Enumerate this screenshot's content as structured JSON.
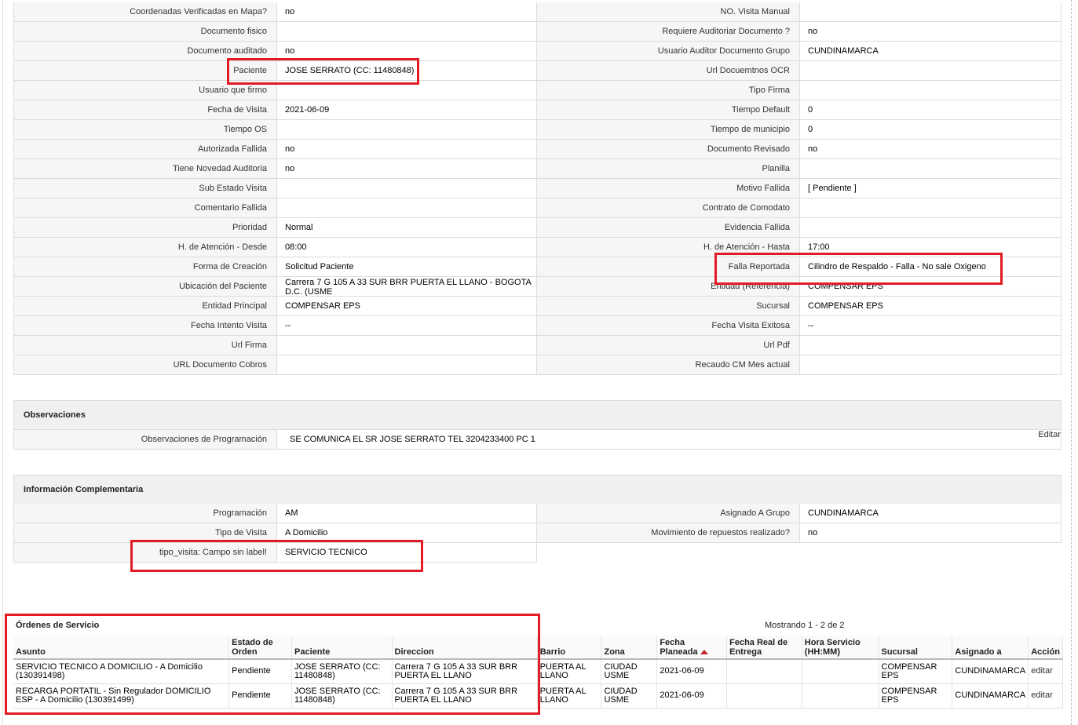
{
  "left_rows_top": [
    {
      "label": "Coordenadas Verificadas en Mapa?",
      "value": "no"
    },
    {
      "label": "Documento fisico",
      "value": ""
    },
    {
      "label": "Documento auditado",
      "value": "no"
    },
    {
      "label": "Paciente",
      "value": "JOSE SERRATO (CC: 11480848)"
    },
    {
      "label": "Usuario que firmo",
      "value": ""
    },
    {
      "label": "Fecha de Visita",
      "value": "2021-06-09"
    },
    {
      "label": "Tiempo OS",
      "value": ""
    },
    {
      "label": "Autorizada Fallida",
      "value": "no"
    },
    {
      "label": "Tiene Novedad Auditoria",
      "value": "no"
    },
    {
      "label": "Sub Estado Visita",
      "value": ""
    },
    {
      "label": "Comentario Fallida",
      "value": ""
    },
    {
      "label": "Prioridad",
      "value": "Normal"
    },
    {
      "label": "H. de Atención - Desde",
      "value": "08:00"
    },
    {
      "label": "Forma de Creación",
      "value": "Solicitud Paciente"
    },
    {
      "label": "Ubicación del Paciente",
      "value": "Carrera 7 G 105 A 33 SUR BRR PUERTA EL LLANO - BOGOTA D.C. (USME"
    },
    {
      "label": "Entidad Principal",
      "value": "COMPENSAR EPS"
    },
    {
      "label": "Fecha Intento Visita",
      "value": "--"
    },
    {
      "label": "Url Firma",
      "value": ""
    },
    {
      "label": "URL Documento Cobros",
      "value": ""
    }
  ],
  "right_rows_top": [
    {
      "label": "NO. Visita Manual",
      "value": ""
    },
    {
      "label": "Requiere Auditoriar Documento ?",
      "value": "no"
    },
    {
      "label": "Usuario Auditor Documento Grupo",
      "value": "CUNDINAMARCA"
    },
    {
      "label": "Url Docuemtnos OCR",
      "value": ""
    },
    {
      "label": "Tipo Firma",
      "value": ""
    },
    {
      "label": "Tiempo Default",
      "value": "0"
    },
    {
      "label": "Tiempo de municipio",
      "value": "0"
    },
    {
      "label": "Documento Revisado",
      "value": "no"
    },
    {
      "label": "Planilla",
      "value": ""
    },
    {
      "label": "Motivo Fallida",
      "value": "[ Pendiente ]"
    },
    {
      "label": "Contrato de Comodato",
      "value": ""
    },
    {
      "label": "Evidencia Fallida",
      "value": ""
    },
    {
      "label": "H. de Atención - Hasta",
      "value": "17:00"
    },
    {
      "label": "Falla Reportada",
      "value": "Cilindro de Respaldo - Falla - No sale Oxigeno"
    },
    {
      "label": "Entidad (Referencia)",
      "value": "COMPENSAR EPS"
    },
    {
      "label": "Sucursal",
      "value": "COMPENSAR EPS"
    },
    {
      "label": "Fecha Visita Exitosa",
      "value": "--"
    },
    {
      "label": "Url Pdf",
      "value": ""
    },
    {
      "label": "Recaudo CM Mes actual",
      "value": ""
    }
  ],
  "observaciones": {
    "title": "Observaciones",
    "label": "Observaciones de Programación",
    "value": "SE COMUNICA EL SR JOSE SERRATO TEL 3204233400 PC 1",
    "edit": "Editar"
  },
  "complementaria": {
    "title": "Información Complementaria",
    "left": [
      {
        "label": "Programación",
        "value": "AM"
      },
      {
        "label": "Tipo de Visita",
        "value": "A Domicilio"
      },
      {
        "label": "tipo_visita: Campo sin label!",
        "value": "SERVICIO TECNICO"
      }
    ],
    "right": [
      {
        "label": "Asignado A Grupo",
        "value": "CUNDINAMARCA"
      },
      {
        "label": "Movimiento de repuestos realizado?",
        "value": "no"
      }
    ]
  },
  "ordenes": {
    "title": "Órdenes de Servicio",
    "showing": "Mostrando 1 - 2 de 2",
    "columns": [
      "Asunto",
      "Estado de Orden",
      "Paciente",
      "Direccion",
      "Barrio",
      "Zona",
      "Fecha Planeada",
      "Fecha Real de Entrega",
      "Hora Servicio (HH:MM)",
      "Sucursal",
      "Asignado a",
      "Acción"
    ],
    "rows": [
      [
        "SERVICIO TECNICO A DOMICILIO - A Domicilio (130391498)",
        "Pendiente",
        "JOSE SERRATO (CC: 11480848)",
        "Carrera 7 G 105 A 33 SUR BRR PUERTA EL LLANO",
        "PUERTA AL LLANO",
        "CIUDAD USME",
        "2021-06-09",
        "",
        "",
        "COMPENSAR EPS",
        "CUNDINAMARCA",
        "editar"
      ],
      [
        "RECARGA PORTATIL - Sin Regulador DOMICILIO ESP - A Domicilio (130391499)",
        "Pendiente",
        "JOSE SERRATO (CC: 11480848)",
        "Carrera 7 G 105 A 33 SUR BRR PUERTA EL LLANO",
        "PUERTA AL LLANO",
        "CIUDAD USME",
        "2021-06-09",
        "",
        "",
        "COMPENSAR EPS",
        "CUNDINAMARCA",
        "editar"
      ]
    ]
  },
  "colors": {
    "highlight": "#e21b25",
    "label_bg": "#f6f6f6",
    "header_bg": "#f0f0f0"
  }
}
